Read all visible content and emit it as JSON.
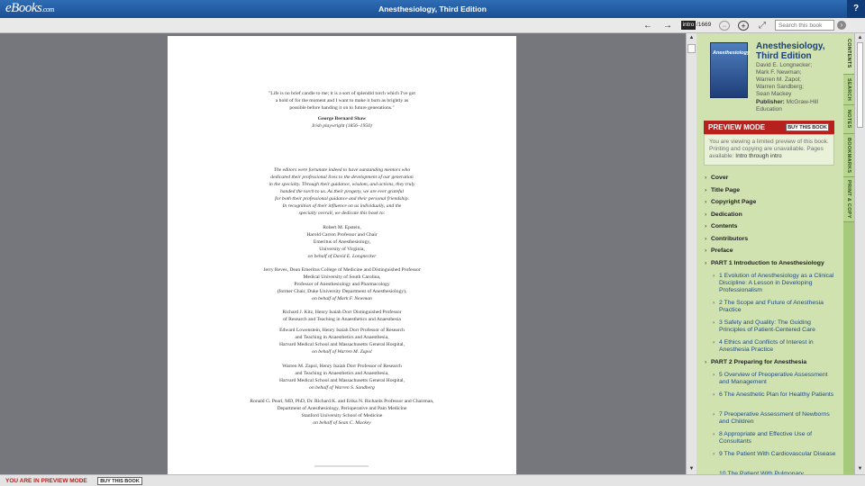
{
  "header": {
    "logo_main": "eBooks",
    "logo_suffix": ".com",
    "title": "Anesthesiology, Third Edition",
    "help_label": "?"
  },
  "toolbar": {
    "back_icon": "←",
    "forward_icon": "→",
    "page_value": "intro",
    "page_total": "/1669",
    "zoom_out_icon": "−",
    "zoom_in_icon": "+",
    "fit_icon": "⤢",
    "search_placeholder": "Search this book",
    "search_go_icon": "›"
  },
  "page": {
    "epigraph": [
      "\"Life is no brief candle to me; it is a sort of splendid torch which I've got",
      "a hold of for the moment and I want to make it burn as brightly as",
      "possible before handing it on to future generations.\""
    ],
    "attrib_name": "George Bernard Shaw",
    "attrib_role": "Irish playwright (1856–1950)",
    "dedication": [
      "The editors were fortunate indeed to have outstanding mentors who",
      "dedicated their professional lives to the development of our generation",
      "in the specialty. Through their guidance, wisdom, and actions, they truly",
      "handed the torch to us. As their progeny, we are ever grateful",
      "for both their professional guidance and their personal friendship.",
      "In recognition of their influence on us individually, and the",
      "specialty overall, we dedicate this book to:"
    ],
    "m1": [
      "Robert M. Epstein,",
      "Harold Carron Professor and Chair",
      "Emeritus of Anesthesiology,",
      "University of Virginia,"
    ],
    "m1b": "on behalf of David E. Longnecker",
    "m2": [
      "Jerry Reves, Dean Emeritus College of Medicine and Distinguished Professor",
      "Medical University of South Carolina,",
      "Professor of Anesthesiology and Pharmacology",
      "(former Chair, Duke University Department of Anesthesiology),"
    ],
    "m2b": "on behalf of Mark F. Newman",
    "m3": [
      "Richard J. Kitz, Henry Isaiah Dorr Distinguished Professor",
      "of Research and Teaching in Anaesthetics and Anaesthesia"
    ],
    "m4": [
      "Edward Lowenstein, Henry Isaiah Dorr Professor of Research",
      "and Teaching in Anaesthetics and Anaesthesia,",
      "Harvard Medical School and Massachusetts General Hospital,"
    ],
    "m4b": "on behalf of Warren M. Zapol",
    "m5": [
      "Warren M. Zapol, Henry Isaiah Dorr Professor of Research",
      "and Teaching in Anaesthetics and Anaesthesia,",
      "Harvard Medical School and Massachusetts General Hospital,"
    ],
    "m5b": "on behalf of Warren S. Sandberg",
    "m6": [
      "Ronald G. Pearl, MD, PhD, Dr. Richard K. and Erika N. Richards Professor and Chairman,",
      "Department of Anesthesiology, Perioperative and Pain Medicine",
      "Stanford University School of Medicine"
    ],
    "m6b": "on behalf of Sean C. Mackey"
  },
  "book": {
    "cover_text": "Anesthesiology",
    "title": "Anesthesiology, Third Edition",
    "authors": [
      "David E. Longnecker;",
      "Mark F. Newman;",
      "Warren M. Zapol;",
      "Warren Sandberg;",
      "Sean Mackey"
    ],
    "publisher_label": "Publisher:",
    "publisher": "McGraw-Hill Education"
  },
  "preview": {
    "heading": "PREVIEW MODE",
    "buy_label": "BUY THIS BOOK",
    "notice": "You are viewing a limited preview of this book. Printing and copying are unavailable.",
    "pages_label": "Pages available:",
    "pages_value": "Intro through intro"
  },
  "toc": [
    {
      "label": "Cover",
      "kind": "top"
    },
    {
      "label": "Title Page",
      "kind": "top"
    },
    {
      "label": "Copyright Page",
      "kind": "top"
    },
    {
      "label": "Dedication",
      "kind": "top"
    },
    {
      "label": "Contents",
      "kind": "top"
    },
    {
      "label": "Contributors",
      "kind": "top"
    },
    {
      "label": "Preface",
      "kind": "top"
    },
    {
      "label": "PART 1 Introduction to Anesthesiology",
      "kind": "top"
    },
    {
      "label": "1 Evolution of Anesthesiology as a Clinical Discipline: A Lesson in Developing Professionalism",
      "kind": "sub"
    },
    {
      "label": "2 The Scope and Future of Anesthesia Practice",
      "kind": "sub"
    },
    {
      "label": "3 Safety and Quality: The Guiding Principles of Patient-Centered Care",
      "kind": "sub"
    },
    {
      "label": "4 Ethics and Conflicts of Interest in Anesthesia Practice",
      "kind": "sub"
    },
    {
      "label": "PART 2 Preparing for Anesthesia",
      "kind": "top"
    },
    {
      "label": "5 Overview of Preoperative Assessment and Management",
      "kind": "sub"
    },
    {
      "label": "6 The Anesthetic Plan for Healthy Patients",
      "kind": "sub"
    },
    {
      "label": "7 Preoperative Assessment of Newborns and Children",
      "kind": "sub"
    },
    {
      "label": "8 Appropriate and Effective Use of Consultants",
      "kind": "sub"
    },
    {
      "label": "9 The Patient With Cardiovascular Disease",
      "kind": "sub"
    },
    {
      "label": "10 The Patient With Pulmonary",
      "kind": "sub"
    }
  ],
  "tabs": [
    "CONTENTS",
    "SEARCH",
    "NOTES",
    "BOOKMARKS",
    "PRINT & COPY"
  ],
  "footer": {
    "mode_text": "YOU ARE IN PREVIEW MODE",
    "buy_label": "BUY THIS BOOK"
  },
  "colors": {
    "header": "#1b4f94",
    "preview_red": "#b6201d",
    "panel_green": "#cfe2b0"
  }
}
